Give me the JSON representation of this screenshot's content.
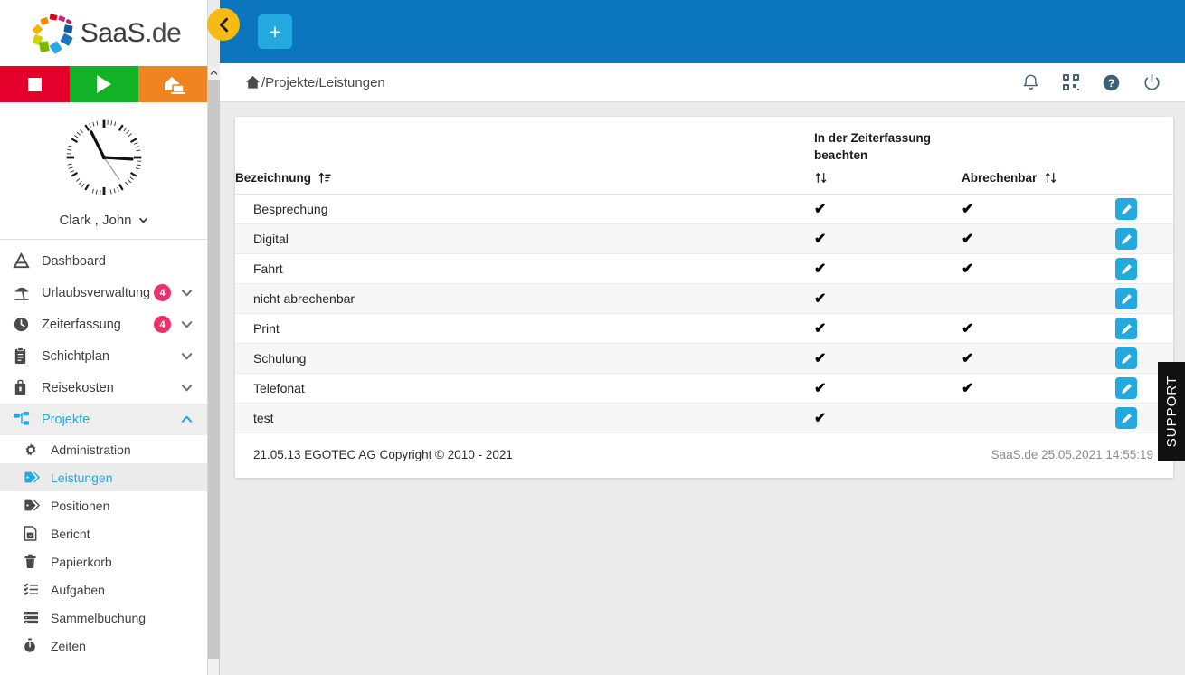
{
  "brand": {
    "logo_text": "SaaS",
    "logo_suffix": ".de",
    "accent_blue": "#0b76bd",
    "light_blue": "#24a8e0",
    "badge_pink": "#e8336d",
    "yellow": "#f5bb14"
  },
  "quickbar": [
    {
      "name": "stop-button",
      "label": "stop-icon",
      "color": "#e4002b"
    },
    {
      "name": "play-button",
      "label": "play-icon",
      "color": "#12b126"
    },
    {
      "name": "homeoffice-button",
      "label": "home-office-icon",
      "color": "#ef8420"
    }
  ],
  "user": {
    "name": "Clark , John",
    "clock_time": "14:55",
    "chevron": "chevron-down-icon"
  },
  "sidebar": {
    "items": [
      {
        "label": "Dashboard",
        "icon": "dashboard-icon",
        "badge": "",
        "chevron": "",
        "active": false
      },
      {
        "label": "Urlaubsverwaltung",
        "icon": "beach-umbrella-icon",
        "badge": "4",
        "chevron": "down",
        "active": false
      },
      {
        "label": "Zeiterfassung",
        "icon": "clock-icon",
        "badge": "4",
        "chevron": "down",
        "active": false
      },
      {
        "label": "Schichtplan",
        "icon": "clipboard-icon",
        "badge": "",
        "chevron": "down",
        "active": false
      },
      {
        "label": "Reisekosten",
        "icon": "briefcase-icon",
        "badge": "",
        "chevron": "down",
        "active": false
      },
      {
        "label": "Projekte",
        "icon": "sitemap-icon",
        "badge": "",
        "chevron": "up",
        "active": true
      }
    ],
    "subitems": [
      {
        "label": "Administration",
        "icon": "gear-icon",
        "active": false
      },
      {
        "label": "Leistungen",
        "icon": "tag-icon",
        "active": true
      },
      {
        "label": "Positionen",
        "icon": "tag-icon",
        "active": false
      },
      {
        "label": "Bericht",
        "icon": "excel-file-icon",
        "active": false
      },
      {
        "label": "Papierkorb",
        "icon": "trash-icon",
        "active": false
      },
      {
        "label": "Aufgaben",
        "icon": "task-list-icon",
        "active": false
      },
      {
        "label": "Sammelbuchung",
        "icon": "server-icon",
        "active": false
      },
      {
        "label": "Zeiten",
        "icon": "stopwatch-icon",
        "active": false
      }
    ]
  },
  "topbar": {
    "back_button": "back-chevron-icon",
    "add_button_label": "+"
  },
  "breadcrumb": {
    "home_icon": "home-icon",
    "path": "/Projekte/Leistungen",
    "actions": [
      {
        "name": "notifications-icon",
        "label": "bell-icon"
      },
      {
        "name": "apps-grid-icon",
        "label": "qr-grid-icon"
      },
      {
        "name": "help-icon",
        "label": "question-mark-icon"
      },
      {
        "name": "power-icon",
        "label": "power-off-icon"
      }
    ]
  },
  "table": {
    "columns": [
      {
        "label": "Bezeichnung",
        "sort": "sort-alpha-asc-icon"
      },
      {
        "label": "In der Zeiterfassung beachten",
        "sort": "sort-updown-icon"
      },
      {
        "label": "Abrechenbar",
        "sort": "sort-updown-icon"
      },
      {
        "label": "",
        "sort": ""
      }
    ],
    "rows": [
      {
        "bezeichnung": "Besprechung",
        "zeiterfassung": true,
        "abrechenbar": true,
        "action": "edit-icon"
      },
      {
        "bezeichnung": "Digital",
        "zeiterfassung": true,
        "abrechenbar": true,
        "action": "edit-icon"
      },
      {
        "bezeichnung": "Fahrt",
        "zeiterfassung": true,
        "abrechenbar": true,
        "action": "edit-icon"
      },
      {
        "bezeichnung": "nicht abrechenbar",
        "zeiterfassung": true,
        "abrechenbar": false,
        "action": "edit-icon"
      },
      {
        "bezeichnung": "Print",
        "zeiterfassung": true,
        "abrechenbar": true,
        "action": "edit-icon"
      },
      {
        "bezeichnung": "Schulung",
        "zeiterfassung": true,
        "abrechenbar": true,
        "action": "edit-icon"
      },
      {
        "bezeichnung": "Telefonat",
        "zeiterfassung": true,
        "abrechenbar": true,
        "action": "edit-icon"
      },
      {
        "bezeichnung": "test",
        "zeiterfassung": true,
        "abrechenbar": false,
        "action": "edit-icon"
      }
    ],
    "checkmark": "✔"
  },
  "footer": {
    "copyright": "21.05.13 EGOTEC AG Copyright © 2010 - 2021",
    "right": "SaaS.de  25.05.2021 14:55:19"
  },
  "support_tab": {
    "label": "SUPPORT"
  }
}
